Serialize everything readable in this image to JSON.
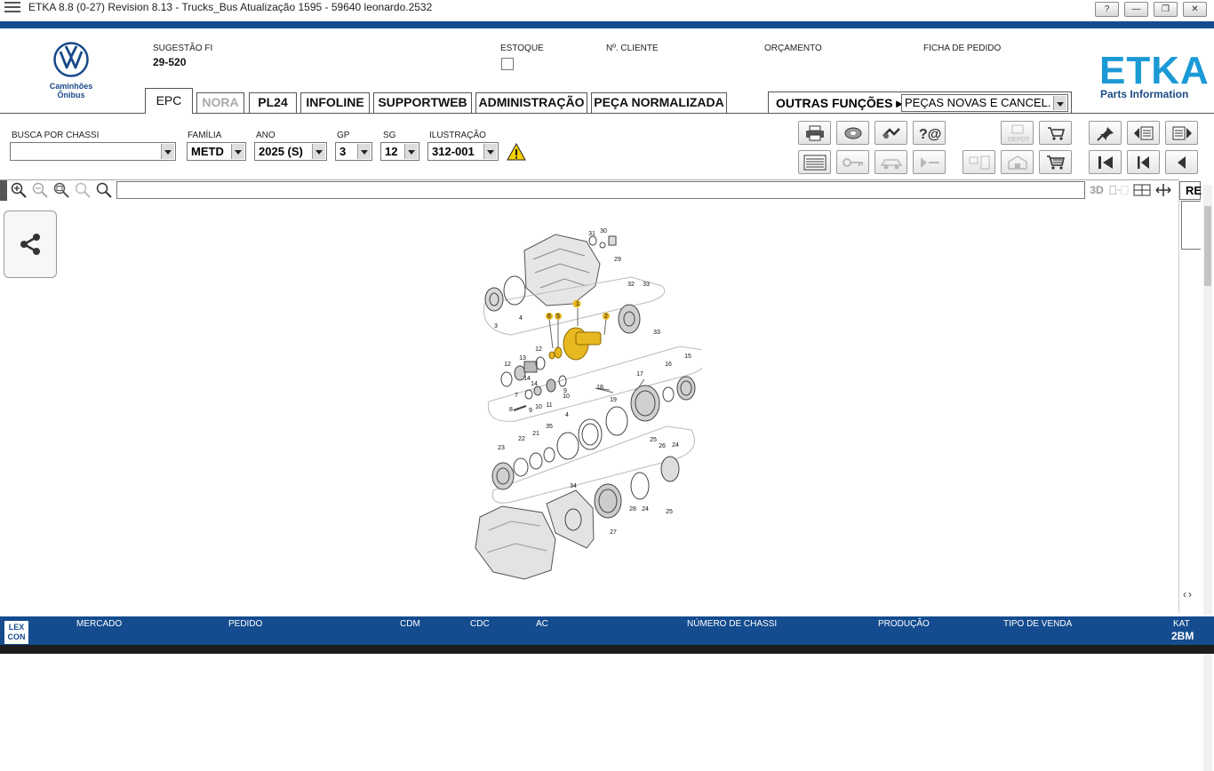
{
  "window": {
    "title": "ETKA 8.8 (0-27) Revision 8.13 - Trucks_Bus Atualização 1595 - 59640 leonardo.2532",
    "buttons": [
      "?",
      "—",
      "❐",
      "✕"
    ]
  },
  "brand": {
    "line1": "Caminhões",
    "line2": "Ônibus",
    "product": "ETKA",
    "product_sub": "Parts Information"
  },
  "header": {
    "sugestao_label": "SUGESTÃO FI",
    "sugestao_value": "29-520",
    "estoque_label": "ESTOQUE",
    "cliente_label": "Nº. CLIENTE",
    "orcamento_label": "ORÇAMENTO",
    "ficha_label": "FICHA DE PEDIDO"
  },
  "tabs": [
    {
      "label": "EPC",
      "state": "active"
    },
    {
      "label": "NORA",
      "state": "disabled"
    },
    {
      "label": "PL24",
      "state": "normal"
    },
    {
      "label": "INFOLINE",
      "state": "normal"
    },
    {
      "label": "SUPPORTWEB",
      "state": "normal"
    },
    {
      "label": "ADMINISTRAÇÃO",
      "state": "normal"
    },
    {
      "label": "PEÇA NORMALIZADA",
      "state": "normal"
    }
  ],
  "other_functions": {
    "label": "OUTRAS FUNÇÕES ▸",
    "selected": "PEÇAS NOVAS E CANCEL."
  },
  "filters": {
    "chassi_label": "BUSCA POR CHASSI",
    "chassi_value": "",
    "familia_label": "FAMÍLIA",
    "familia_value": "METD",
    "ano_label": "ANO",
    "ano_value": "2025 (S)",
    "gp_label": "GP",
    "gp_value": "3",
    "sg_label": "SG",
    "sg_value": "12",
    "ilustracao_label": "ILUSTRAÇÃO",
    "ilustracao_value": "312-001"
  },
  "toolbar": {
    "depot_label": "DEPOT"
  },
  "viewer": {
    "mode_3d": "3D",
    "right_tab": "RE"
  },
  "diagram": {
    "callouts": [
      "31",
      "30",
      "29",
      "32",
      "33",
      "33",
      "1",
      "6",
      "5",
      "2",
      "3",
      "4",
      "12",
      "13",
      "12",
      "14",
      "14",
      "7",
      "8",
      "9",
      "10",
      "11",
      "9",
      "10",
      "16",
      "15",
      "17",
      "18",
      "19",
      "4",
      "35",
      "21",
      "22",
      "23",
      "25",
      "26",
      "24",
      "34",
      "28",
      "24",
      "25",
      "27"
    ]
  },
  "footer": {
    "labels": [
      "MERCADO",
      "PEDIDO",
      "CDM",
      "CDC",
      "AC",
      "NÚMERO DE CHASSI",
      "PRODUÇÃO",
      "TIPO DE VENDA"
    ],
    "kat_label": "KAT",
    "kat_value": "2BM",
    "logo": "LEX CON"
  },
  "colors": {
    "brand_blue": "#144c8f",
    "etka_blue": "#1c9ad6",
    "highlight": "#e8b820"
  }
}
